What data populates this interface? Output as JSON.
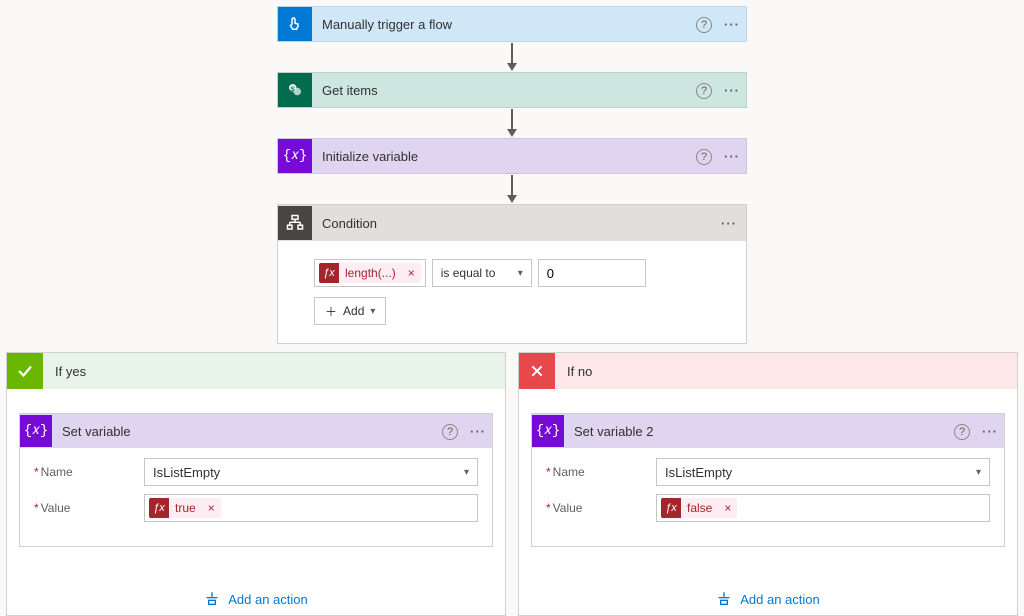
{
  "steps": {
    "trigger": {
      "title": "Manually trigger a flow"
    },
    "getitems": {
      "title": "Get items"
    },
    "initvar": {
      "title": "Initialize variable"
    },
    "condition": {
      "title": "Condition",
      "left_expression": "length(...)",
      "operator": "is equal to",
      "right_value": "0",
      "add_label": "Add"
    }
  },
  "branches": {
    "yes": {
      "label": "If yes",
      "setvar": {
        "title": "Set variable",
        "name_label": "Name",
        "value_label": "Value",
        "name_value": "IsListEmpty",
        "expression": "true"
      },
      "add_action": "Add an action"
    },
    "no": {
      "label": "If no",
      "setvar": {
        "title": "Set variable 2",
        "name_label": "Name",
        "value_label": "Value",
        "name_value": "IsListEmpty",
        "expression": "false"
      },
      "add_action": "Add an action"
    }
  }
}
